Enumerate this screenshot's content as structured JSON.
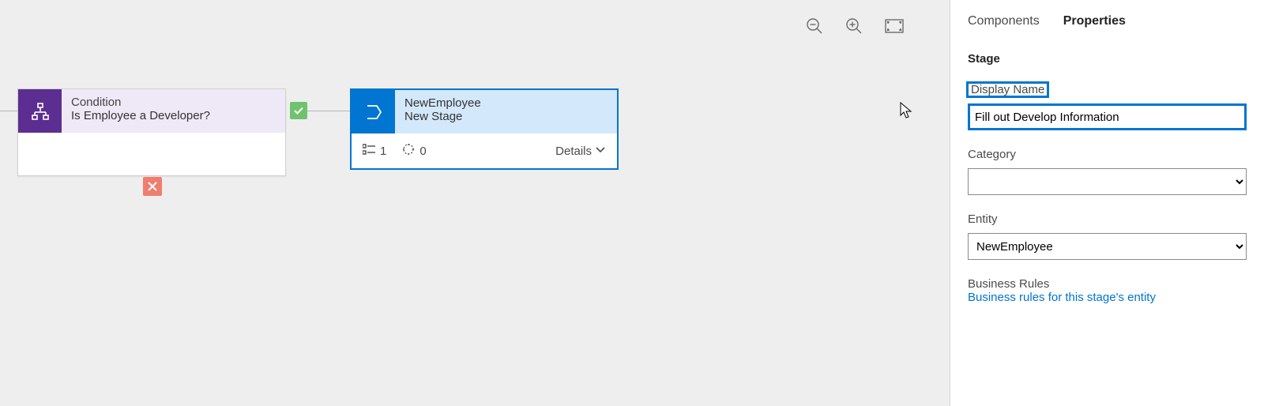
{
  "toolbar": {
    "zoom_out_name": "zoom-out-icon",
    "zoom_in_name": "zoom-in-icon",
    "fit_name": "fit-to-screen-icon"
  },
  "condition": {
    "type_label": "Condition",
    "title": "Is Employee a Developer?"
  },
  "stage": {
    "entity_label": "NewEmployee",
    "name_label": "New Stage",
    "steps_count": "1",
    "triggers_count": "0",
    "details_label": "Details"
  },
  "panel": {
    "tab_components": "Components",
    "tab_properties": "Properties",
    "section_title": "Stage",
    "display_name_label": "Display Name",
    "display_name_value": "Fill out Develop Information",
    "category_label": "Category",
    "category_value": "",
    "entity_label": "Entity",
    "entity_value": "NewEmployee",
    "business_rules_label": "Business Rules",
    "business_rules_link": "Business rules for this stage's entity"
  }
}
